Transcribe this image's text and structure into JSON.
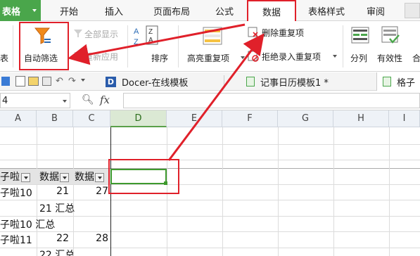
{
  "menubar": {
    "app_label": "表格",
    "tabs": [
      "开始",
      "插入",
      "页面布局",
      "公式",
      "数据",
      "表格样式",
      "审阅"
    ],
    "active_tab": "数据"
  },
  "ribbon": {
    "left_cut_label": "表",
    "autofilter": "自动筛选",
    "show_all": "全部显示",
    "reapply": "重新应用",
    "sort": "排序",
    "highlight_dup": "高亮重复项",
    "remove_dup": "删除重复项",
    "reject_dup": "拒绝录入重复项",
    "split": "分列",
    "validity": "有效性",
    "partial_right": "合"
  },
  "doc_tabs": {
    "docer": "Docer-在线模板",
    "calendar": "记事日历模板1 *",
    "partial": "格子"
  },
  "formula_bar": {
    "name_box": "4",
    "fx": "fx"
  },
  "grid": {
    "columns": [
      "A",
      "B",
      "C",
      "D",
      "E",
      "F",
      "G",
      "H",
      "I"
    ],
    "selected_column": "D",
    "header_row": {
      "a": "子啦",
      "b": "数据",
      "c": "数据"
    },
    "rows": [
      {
        "a": "子啦10",
        "b": "21",
        "c": "27"
      },
      {
        "a": "",
        "b": "21 汇总",
        "c": ""
      },
      {
        "a": "子啦10 汇总",
        "b": "",
        "c": ""
      },
      {
        "a": "子啦11",
        "b": "22",
        "c": "28"
      },
      {
        "a": "",
        "b": "22 汇总",
        "c": ""
      }
    ]
  },
  "colors": {
    "accent_green": "#4aa64b",
    "annotation_red": "#e0202a",
    "selection_green": "#3e9a2e"
  }
}
